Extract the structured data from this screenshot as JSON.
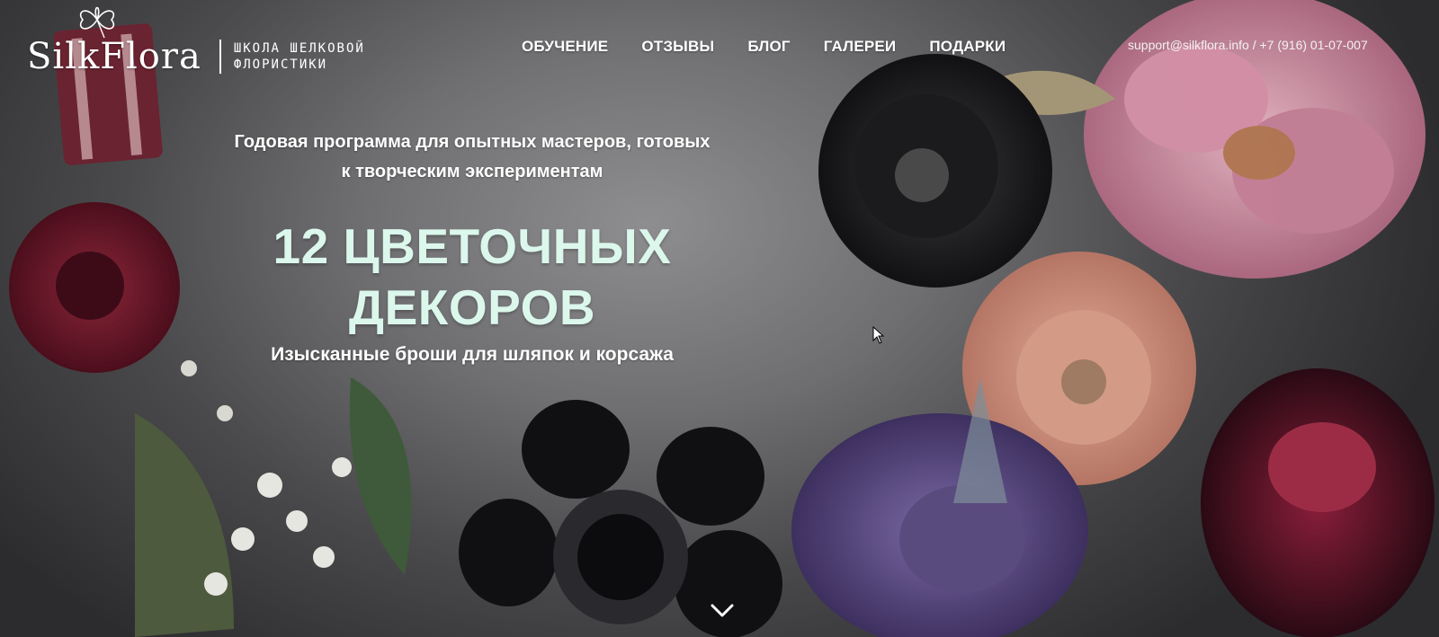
{
  "brand": {
    "logo_text": "SilkFlora",
    "tagline_line1": "школа шелковой",
    "tagline_line2": "флористики"
  },
  "nav": {
    "items": [
      "ОБУЧЕНИЕ",
      "ОТЗЫВЫ",
      "БЛОГ",
      "ГАЛЕРЕИ",
      "ПОДАРКИ"
    ]
  },
  "contact": {
    "email": "support@silkflora.info",
    "separator": " / ",
    "phone": "+7 (916) 01-07-007"
  },
  "hero": {
    "intro_line1": "Годовая программа для опытных мастеров, готовых",
    "intro_line2": "к творческим экспериментам",
    "headline_line1": "12 ЦВЕТОЧНЫХ",
    "headline_line2": "ДЕКОРОВ",
    "subline": "Изысканные броши для шляпок и корсажа"
  },
  "icons": {
    "scroll": "chevron-down-icon",
    "logo": "clover-icon"
  },
  "colors": {
    "headline": "#dcf7ec",
    "text": "#ffffff",
    "background": "#6f6f72"
  }
}
